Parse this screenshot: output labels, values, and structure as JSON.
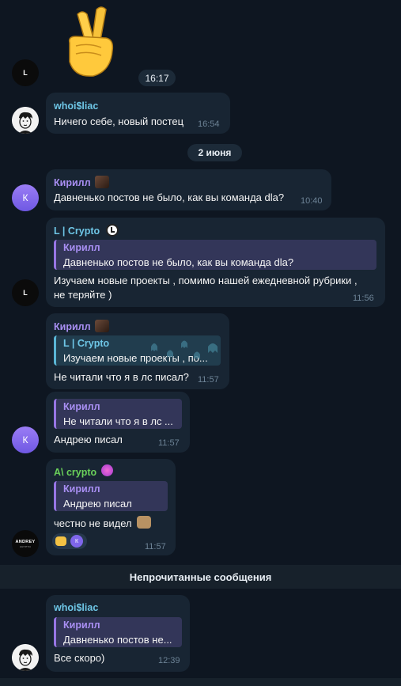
{
  "colors": {
    "background": "#0e1621",
    "bubble": "#182533",
    "name_teal": "#6ec6e6",
    "name_purple": "#a98ff3",
    "name_green": "#6ad15a",
    "time": "#6d8396"
  },
  "top": {
    "sticker": "crossed-fingers-emoji",
    "time": "16:17",
    "avatar_label": "L"
  },
  "messages": {
    "m1": {
      "sender": "whoi$liac",
      "text": "Ничего себе, новый постец",
      "time": "16:54"
    },
    "date_divider": "2 июня",
    "m2": {
      "sender": "Кирилл",
      "avatar_letter": "К",
      "text": "Давненько постов не было, как вы команда dla?",
      "time": "10:40"
    },
    "m3": {
      "sender": "L | Crypto",
      "reply_name": "Кирилл",
      "reply_text": "Давненько постов не было, как вы команда dla?",
      "text_line1": "Изучаем новые проекты , помимо нашей ежедневной рубрики ,",
      "text_line2": "не теряйте )",
      "time": "11:56"
    },
    "m4": {
      "sender": "Кирилл",
      "reply_name": "L | Crypto",
      "reply_text": "Изучаем новые проекты , по...",
      "text": "Не читали что я в лс писал?",
      "time": "11:57"
    },
    "m5": {
      "reply_name": "Кирилл",
      "reply_text": "Не читали что я в лс ...",
      "text": "Андрею писал",
      "time": "11:57",
      "avatar_letter": "К"
    },
    "m6": {
      "sender": "A\\ crypto",
      "reply_name": "Кирилл",
      "reply_text": "Андрею писал",
      "text": "честно не видел",
      "reaction_avatar": "К",
      "time": "11:57",
      "avatar_line1": "ANDREY",
      "avatar_line2": "CRYPTO"
    },
    "unread_divider": "Непрочитанные сообщения",
    "m7": {
      "sender": "whoi$liac",
      "reply_name": "Кирилл",
      "reply_text": "Давненько постов не...",
      "text": "Все скоро)",
      "time": "12:39"
    }
  }
}
